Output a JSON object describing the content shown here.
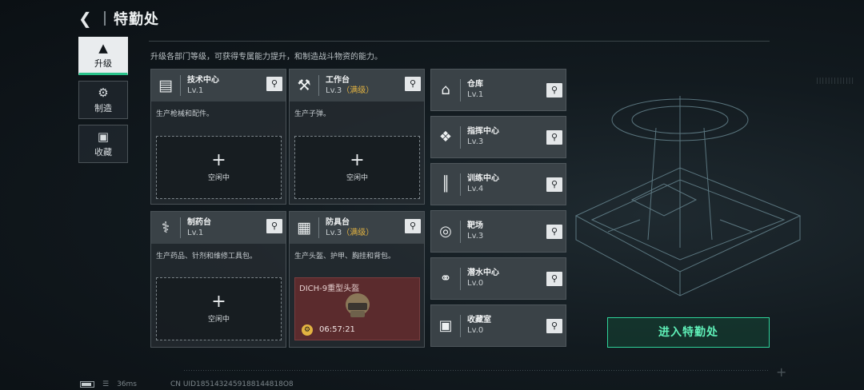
{
  "header": {
    "title": "特勤处"
  },
  "nav": [
    {
      "label": "升级",
      "icon": "upgrade-icon",
      "active": true
    },
    {
      "label": "制造",
      "icon": "gears-icon",
      "active": false
    },
    {
      "label": "收藏",
      "icon": "collection-icon",
      "active": false
    }
  ],
  "description": "升级各部门等级，可获得专属能力提升，和制造战斗物资的能力。",
  "cards": [
    {
      "name": "技术中心",
      "level": "Lv.1",
      "max": "",
      "desc": "生产枪械和配件。",
      "icon": "computer-icon",
      "slot": "空闲中"
    },
    {
      "name": "工作台",
      "level": "Lv.3",
      "max": "（满级）",
      "desc": "生产子弹。",
      "icon": "tools-icon",
      "slot": "空闲中"
    },
    {
      "name": "制药台",
      "level": "Lv.1",
      "max": "",
      "desc": "生产药品、针剂和维修工具包。",
      "icon": "microscope-icon",
      "slot": "空闲中"
    },
    {
      "name": "防具台",
      "level": "Lv.3",
      "max": "（满级）",
      "desc": "生产头盔、护甲、胸挂和背包。",
      "icon": "armor-icon",
      "crafting": {
        "item": "DICH-9重型头盔",
        "time": "06:57:21"
      }
    }
  ],
  "facilities": [
    {
      "name": "仓库",
      "level": "Lv.1",
      "icon": "warehouse-icon"
    },
    {
      "name": "指挥中心",
      "level": "Lv.3",
      "icon": "command-icon"
    },
    {
      "name": "训练中心",
      "level": "Lv.4",
      "icon": "dumbbell-icon"
    },
    {
      "name": "靶场",
      "level": "Lv.3",
      "icon": "target-icon"
    },
    {
      "name": "潜水中心",
      "level": "Lv.0",
      "icon": "diving-mask-icon"
    },
    {
      "name": "收藏室",
      "level": "Lv.0",
      "icon": "vault-icon"
    }
  ],
  "enter_button": "进入特勤处",
  "status": {
    "ping": "36ms",
    "uid": "CN UID1851432459188144818O8"
  },
  "colors": {
    "accent": "#2fd39a",
    "max_level": "#e3b341",
    "crafting_bg": "#5b2b2d"
  }
}
